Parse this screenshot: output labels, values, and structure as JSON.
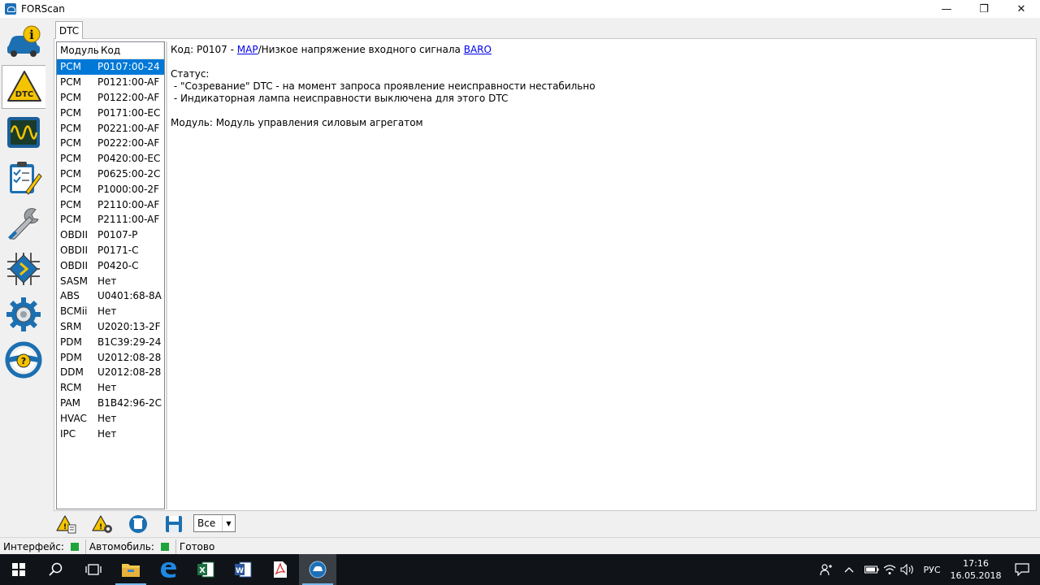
{
  "window": {
    "title": "FORScan",
    "minimize": "—",
    "restore": "❐",
    "close": "✕"
  },
  "sidebar": {
    "items": [
      {
        "name": "vehicle-info",
        "icon": "car-info-icon"
      },
      {
        "name": "dtc",
        "icon": "dtc-warning-icon",
        "active": true
      },
      {
        "name": "oscilloscope",
        "icon": "oscilloscope-icon"
      },
      {
        "name": "tests",
        "icon": "checklist-icon"
      },
      {
        "name": "service",
        "icon": "wrench-icon"
      },
      {
        "name": "configuration",
        "icon": "chip-icon"
      },
      {
        "name": "settings",
        "icon": "gear-icon"
      },
      {
        "name": "help",
        "icon": "help-wheel-icon"
      }
    ]
  },
  "tab": {
    "label": "DTC"
  },
  "list": {
    "headers": {
      "module": "Модуль",
      "code": "Код"
    },
    "rows": [
      {
        "module": "PCM",
        "code": "P0107:00-24",
        "selected": true
      },
      {
        "module": "PCM",
        "code": "P0121:00-AF"
      },
      {
        "module": "PCM",
        "code": "P0122:00-AF"
      },
      {
        "module": "PCM",
        "code": "P0171:00-EC"
      },
      {
        "module": "PCM",
        "code": "P0221:00-AF"
      },
      {
        "module": "PCM",
        "code": "P0222:00-AF"
      },
      {
        "module": "PCM",
        "code": "P0420:00-EC"
      },
      {
        "module": "PCM",
        "code": "P0625:00-2C"
      },
      {
        "module": "PCM",
        "code": "P1000:00-2F"
      },
      {
        "module": "PCM",
        "code": "P2110:00-AF"
      },
      {
        "module": "PCM",
        "code": "P2111:00-AF"
      },
      {
        "module": "OBDII",
        "code": "P0107-P"
      },
      {
        "module": "OBDII",
        "code": "P0171-C"
      },
      {
        "module": "OBDII",
        "code": "P0420-C"
      },
      {
        "module": "SASM",
        "code": "Нет"
      },
      {
        "module": "ABS",
        "code": "U0401:68-8A"
      },
      {
        "module": "BCMii",
        "code": "Нет"
      },
      {
        "module": "SRM",
        "code": "U2020:13-2F"
      },
      {
        "module": "PDM",
        "code": "B1C39:29-24"
      },
      {
        "module": "PDM",
        "code": "U2012:08-28"
      },
      {
        "module": "DDM",
        "code": "U2012:08-28"
      },
      {
        "module": "RCM",
        "code": "Нет"
      },
      {
        "module": "PAM",
        "code": "B1B42:96-2C"
      },
      {
        "module": "HVAC",
        "code": "Нет"
      },
      {
        "module": "IPC",
        "code": "Нет"
      }
    ]
  },
  "details": {
    "code_prefix": "Код: P0107 - ",
    "map_link": "MAP",
    "code_middle": "/Низкое напряжение входного сигнала ",
    "baro_link": "BARO",
    "status_label": "Статус:",
    "status_lines": [
      " - \"Созревание\" DTC - на момент запроса проявление неисправности нестабильно",
      " - Индикаторная лампа неисправности выключена для этого DTC"
    ],
    "module_line": "Модуль: Модуль управления силовым агрегатом"
  },
  "toolbar": {
    "filter_value": "Все",
    "buttons": [
      "read-dtc-icon",
      "clear-dtc-icon",
      "delete-icon",
      "save-icon"
    ]
  },
  "status": {
    "interface_label": "Интерфейс:",
    "vehicle_label": "Автомобиль:",
    "state": "Готово",
    "ok_color": "#1fa33a"
  },
  "taskbar": {
    "apps": [
      "windows-start-icon",
      "search-icon",
      "task-view-icon",
      "file-explorer-icon",
      "edge-icon",
      "excel-icon",
      "word-icon",
      "pdf-icon",
      "forscan-icon"
    ],
    "lang": "РУС",
    "time": "17:16",
    "date": "16.05.2018"
  }
}
